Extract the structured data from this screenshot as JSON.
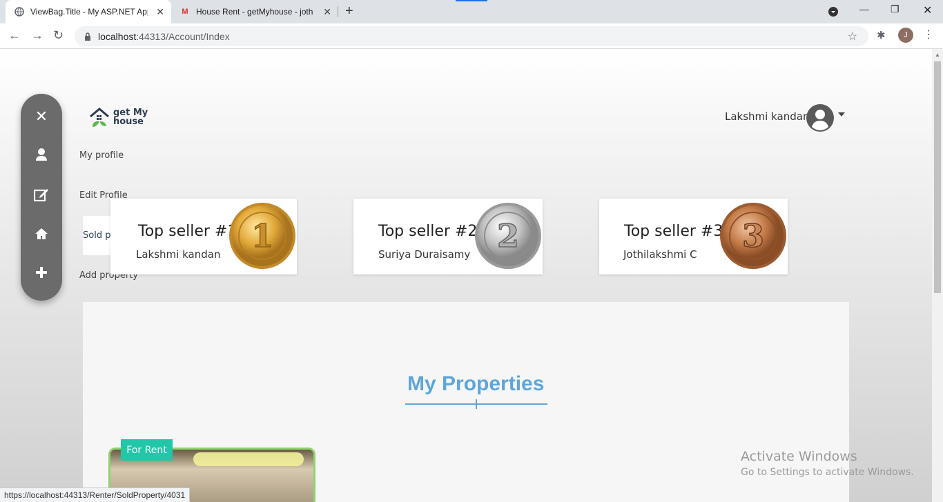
{
  "browser": {
    "tabs": [
      {
        "title": "ViewBag.Title - My ASP.NET Appl",
        "icon": "globe-icon"
      },
      {
        "title": "House Rent - getMyhouse - jothi",
        "icon": "gmail-icon"
      }
    ],
    "url_host": "localhost",
    "url_path": ":44313/Account/Index",
    "profile_initial": "J"
  },
  "sidebar": {
    "items": [
      {
        "label": "My profile",
        "icon": "user-icon"
      },
      {
        "label": "Edit Profile",
        "icon": "edit-icon"
      },
      {
        "label": "Sold property",
        "icon": "home-icon"
      },
      {
        "label": "Add property",
        "icon": "plus-icon"
      }
    ]
  },
  "logo": {
    "line1": "get My",
    "line2": "house"
  },
  "user": {
    "name": "Lakshmi kandan"
  },
  "sellers": [
    {
      "title": "Top seller #1",
      "name": "Lakshmi kandan",
      "rank": "1",
      "medal": "gold"
    },
    {
      "title": "Top seller #2",
      "name": "Suriya Duraisamy",
      "rank": "2",
      "medal": "silver"
    },
    {
      "title": "Top seller #3",
      "name": "Jothilakshmi C",
      "rank": "3",
      "medal": "bronze"
    }
  ],
  "main": {
    "title": "My Properties",
    "badge": "For Rent"
  },
  "overlay": {
    "activate_title": "Activate Windows",
    "activate_sub": "Go to Settings to activate Windows."
  },
  "status_url": "https://localhost:44313/Renter/SoldProperty/4031",
  "colors": {
    "accent": "#5ea6da",
    "badge": "#21c7a8",
    "sidebar": "#6b6b6b"
  }
}
